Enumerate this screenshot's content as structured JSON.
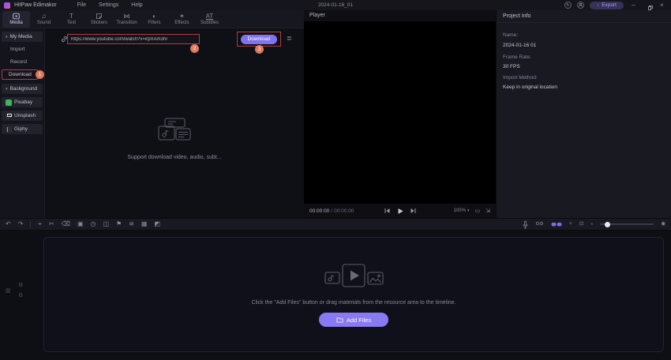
{
  "titlebar": {
    "app_name": "HitPaw Edimakor",
    "menus": [
      {
        "label": "File"
      },
      {
        "label": "Settings"
      },
      {
        "label": "Help"
      }
    ],
    "project_title": "2024-01-16_01",
    "export_label": "Export"
  },
  "ribbon": {
    "tabs": [
      {
        "label": "Media"
      },
      {
        "label": "Sound"
      },
      {
        "label": "Text"
      },
      {
        "label": "Stickers"
      },
      {
        "label": "Transition"
      },
      {
        "label": "Filters"
      },
      {
        "label": "Effects"
      },
      {
        "label": "Subtitles"
      }
    ]
  },
  "sidebar": {
    "items": [
      {
        "label": "My Media"
      },
      {
        "label": "Import"
      },
      {
        "label": "Record"
      },
      {
        "label": "Download"
      },
      {
        "label": "Background"
      },
      {
        "label": "Pixabay"
      },
      {
        "label": "Unsplash"
      },
      {
        "label": "Giphy"
      }
    ]
  },
  "media_panel": {
    "url_value": "https://www.youtube.com/watch?v=irpXAm3hI",
    "download_button": "Download",
    "empty_text": "Support download video, audio, subt..."
  },
  "annotations": {
    "step_1": "1",
    "step_2": "2",
    "step_3": "3"
  },
  "player": {
    "title": "Player",
    "time_current": "00:00:00",
    "time_separator": "/",
    "time_total": "00:00:00",
    "zoom_level": "100%"
  },
  "project_info": {
    "title": "Project Info",
    "fields": [
      {
        "label": "Name:",
        "value": "2024-01-16 01"
      },
      {
        "label": "Frame Rate:",
        "value": "30 FPS"
      },
      {
        "label": "Import Method:",
        "value": "Keep in original location"
      }
    ]
  },
  "timeline": {
    "empty_text": "Click the \"Add Files\" button or drag materials from the resource area to the timeline.",
    "add_files_label": "Add Files"
  },
  "icons": {
    "caret_down": "▾",
    "sound": "♫",
    "text_tool": "T",
    "transition": "⋈",
    "filters": "◐",
    "effects": "✶",
    "subtitles": "AT",
    "download_list": "≣",
    "undo": "↶",
    "redo": "↷",
    "tool_select": "⌖",
    "tool_split": "✂",
    "tool_delete": "⌫",
    "tool_crop": "▣",
    "tool_speed": "◷",
    "tool_pip": "◫",
    "tool_marker": "⚑",
    "tool_audio": "≋",
    "tool_grid": "▦",
    "tool_mask": "◩",
    "od": "OD",
    "snap_plus": "+",
    "viewport": "⊡",
    "zoom_dot": "●",
    "zoom_fit": "◉",
    "track_menu": "☰",
    "gear": "⚙",
    "track_tile": "▥",
    "update": "↻",
    "export_arrow": "↑",
    "minimize": "–",
    "close": "×",
    "zoom_caret": "▾",
    "ratio": "▭",
    "fullscreen": "⇲"
  },
  "colors": {
    "accent": "#8172f0",
    "annotation_red": "#ae3f3f",
    "badge_orange": "#dd7a5a"
  }
}
